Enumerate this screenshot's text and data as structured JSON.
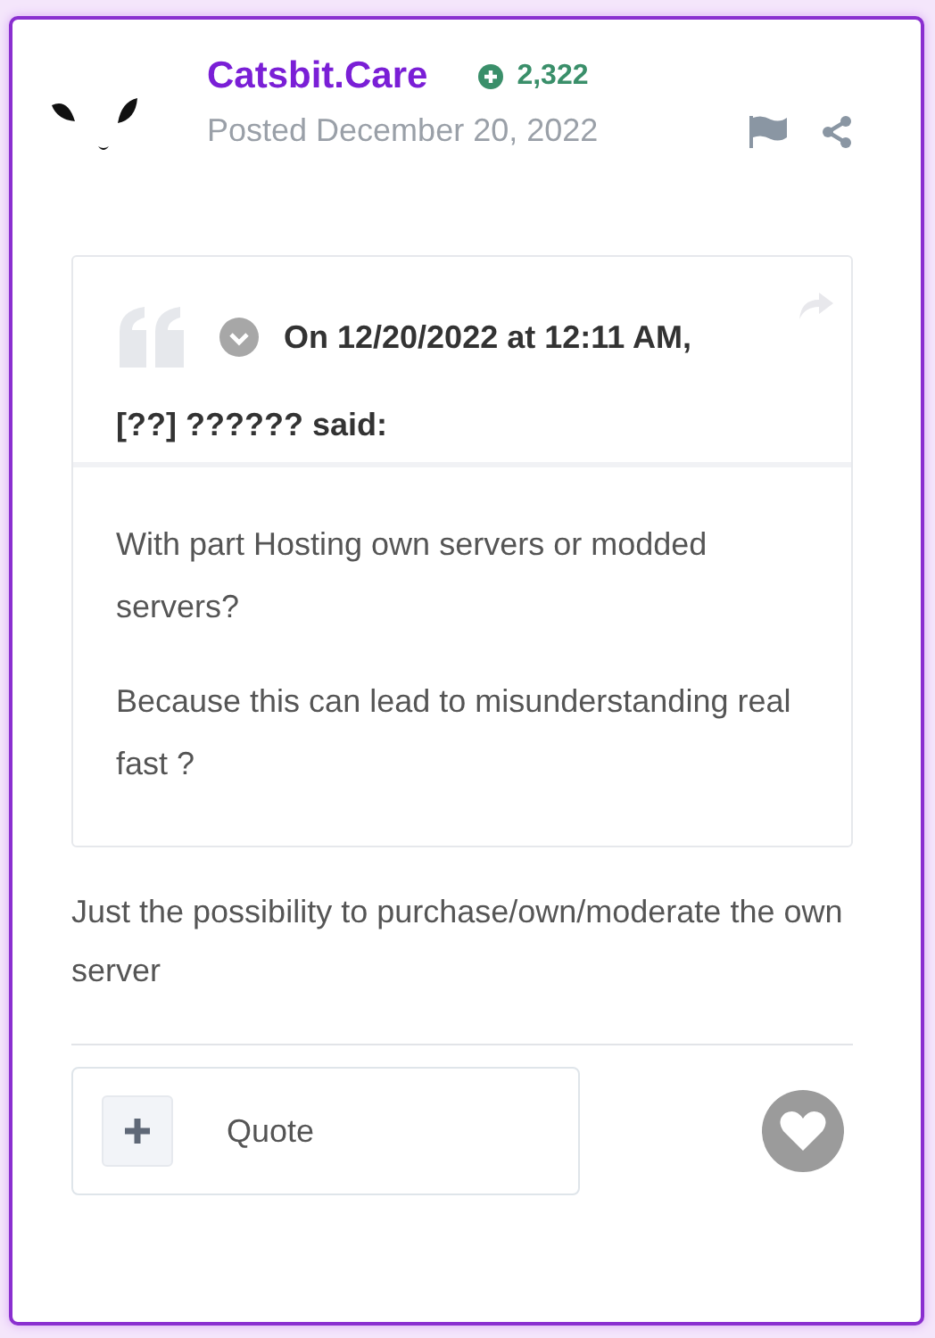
{
  "author": {
    "name": "Catsbit.Care",
    "reputation": "2,322",
    "posted": "Posted December 20, 2022"
  },
  "quote": {
    "header": "On 12/20/2022 at 12:11 AM,",
    "said": "[??] ?????? said:",
    "paragraphs": [
      "With part Hosting own servers or modded servers?",
      "Because this can lead to misunderstanding real fast ?"
    ]
  },
  "body": "Just the possibility to purchase/own/moderate the own server",
  "actions": {
    "quote_button": "Quote",
    "liked": false
  }
}
